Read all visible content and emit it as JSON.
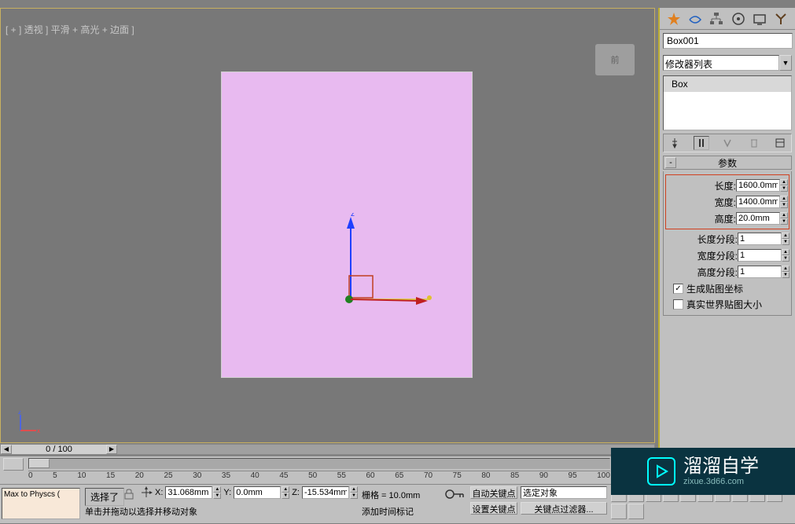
{
  "viewport": {
    "label": "[ + ] 透视 ] 平滑 + 高光 + 边面 ]",
    "viewcube_face": "前"
  },
  "object": {
    "name": "Box001",
    "color": "#e8baf0"
  },
  "modifier_list": "修改器列表",
  "stack": {
    "items": [
      "Box"
    ]
  },
  "rollup": {
    "title": "参数",
    "toggle": "-"
  },
  "params": {
    "length": {
      "label": "长度:",
      "value": "1600.0mm"
    },
    "width": {
      "label": "宽度:",
      "value": "1400.0mm"
    },
    "height": {
      "label": "高度:",
      "value": "20.0mm"
    },
    "lsegs": {
      "label": "长度分段:",
      "value": "1"
    },
    "wsegs": {
      "label": "宽度分段:",
      "value": "1"
    },
    "hsegs": {
      "label": "高度分段:",
      "value": "1"
    },
    "gen_uv": {
      "label": "生成贴图坐标",
      "checked": "✓"
    },
    "real_scale": {
      "label": "真实世界贴图大小",
      "checked": ""
    }
  },
  "timeline": {
    "frame": "0 / 100",
    "ticks": [
      "0",
      "5",
      "10",
      "15",
      "20",
      "25",
      "30",
      "35",
      "40",
      "45",
      "50",
      "55",
      "60",
      "65",
      "70",
      "75",
      "80",
      "85",
      "90",
      "95",
      "100"
    ]
  },
  "status": {
    "script": "Max to Physcs (",
    "selected": "选择了",
    "x_label": "X:",
    "x_val": "31.068mm",
    "y_label": "Y:",
    "y_val": "0.0mm",
    "z_label": "Z:",
    "z_val": "-15.534mm",
    "grid": "栅格 = 10.0mm",
    "auto_key": "自动关键点",
    "sel_obj": "选定对象",
    "hint": "单击并拖动以选择并移动对象",
    "add_marker": "添加时间标记",
    "set_key": "设置关键点",
    "key_filter": "关键点过滤器..."
  },
  "watermark": {
    "title": "溜溜自学",
    "sub": "zixue.3d66.com"
  }
}
